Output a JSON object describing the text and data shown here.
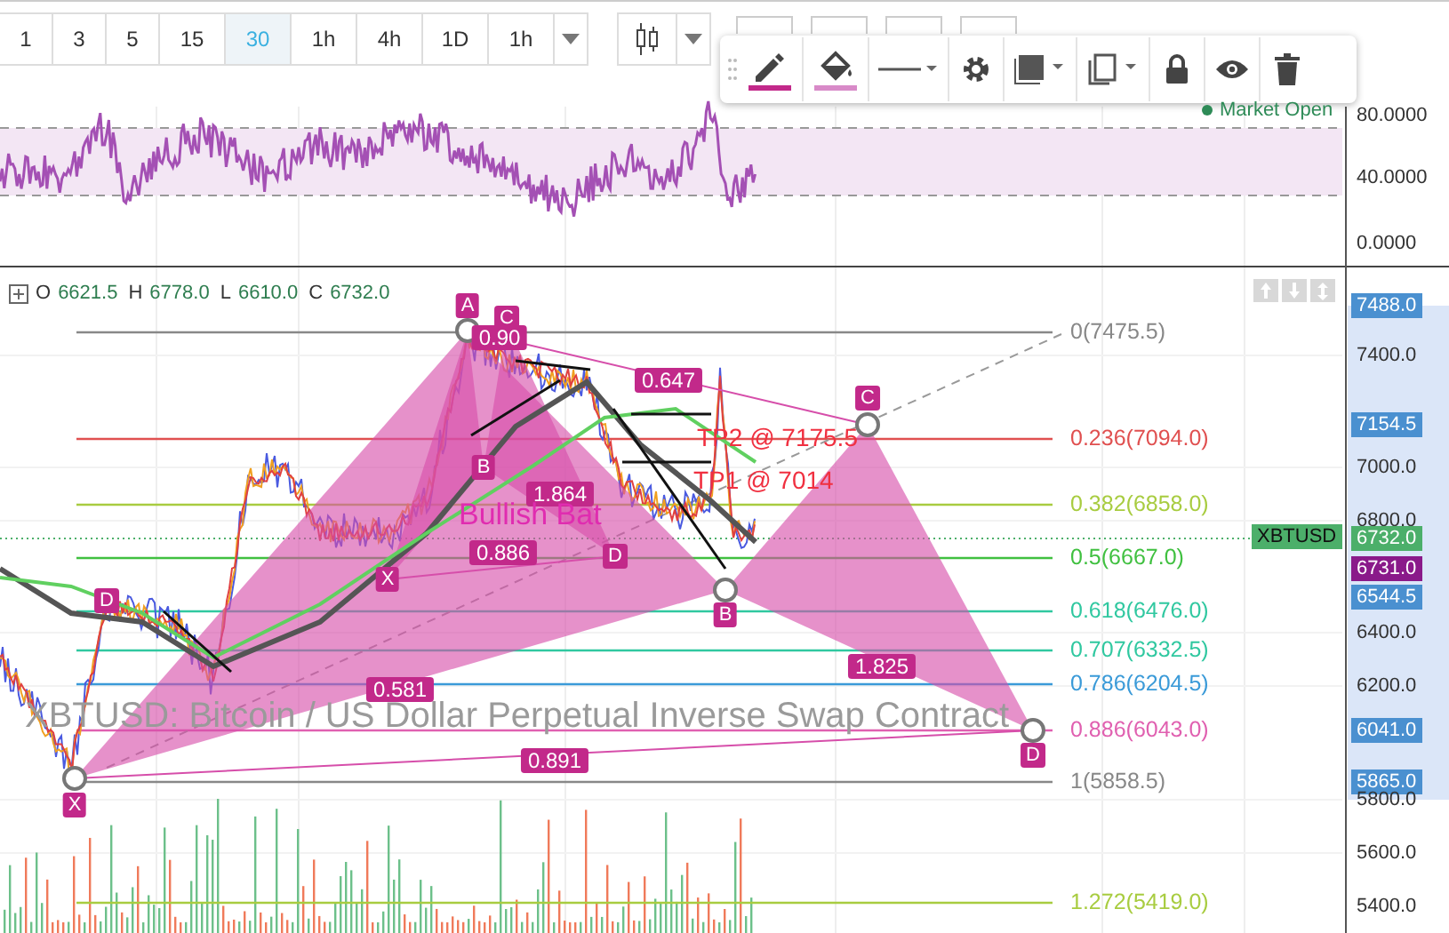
{
  "toolbar": {
    "intervals": [
      {
        "label": "1",
        "selected": false
      },
      {
        "label": "3",
        "selected": false
      },
      {
        "label": "5",
        "selected": false
      },
      {
        "label": "15",
        "selected": false
      },
      {
        "label": "30",
        "selected": true
      },
      {
        "label": "1h",
        "selected": false
      },
      {
        "label": "4h",
        "selected": false
      },
      {
        "label": "1D",
        "selected": false
      },
      {
        "label": "1h",
        "selected": false
      }
    ]
  },
  "rsi_pane": {
    "status": "Market Open",
    "axis_labels": [
      "80.0000",
      "40.0000",
      "0.0000"
    ]
  },
  "price_pane": {
    "ohlc": [
      {
        "key": "O",
        "value": "6621.5"
      },
      {
        "key": "H",
        "value": "6778.0"
      },
      {
        "key": "L",
        "value": "6610.0"
      },
      {
        "key": "C",
        "value": "6732.0"
      }
    ],
    "watermark": {
      "description": "XBTUSD: Bitcoin / US Dollar Perpetual Inverse Swap Contract"
    },
    "symbol_tag": "XBTUSD",
    "axis_labels": [
      {
        "text": "7488.0",
        "kind": "badge",
        "color": "#4a90d0"
      },
      {
        "text": "7400.0",
        "kind": "tick"
      },
      {
        "text": "7154.5",
        "kind": "badge",
        "color": "#4a90d0"
      },
      {
        "text": "7000.0",
        "kind": "tick"
      },
      {
        "text": "6800.0",
        "kind": "tick"
      },
      {
        "text": "6732.0",
        "kind": "badge",
        "color": "#4caf6a"
      },
      {
        "text": "6731.0",
        "kind": "badge",
        "color": "#8a1a8a"
      },
      {
        "text": "6544.5",
        "kind": "badge",
        "color": "#4a90d0"
      },
      {
        "text": "6400.0",
        "kind": "tick"
      },
      {
        "text": "6200.0",
        "kind": "tick"
      },
      {
        "text": "6041.0",
        "kind": "badge",
        "color": "#4a90d0"
      },
      {
        "text": "5865.0",
        "kind": "badge",
        "color": "#4a90d0"
      },
      {
        "text": "5800.0",
        "kind": "tick"
      },
      {
        "text": "5600.0",
        "kind": "tick"
      },
      {
        "text": "5400.0",
        "kind": "tick"
      }
    ],
    "fib_levels": [
      {
        "label": "0(7475.5)",
        "color": "#888888"
      },
      {
        "label": "0.236(7094.0)",
        "color": "#e05050"
      },
      {
        "label": "0.382(6858.0)",
        "color": "#a8cc40"
      },
      {
        "label": "0.5(6667.0)",
        "color": "#40c040"
      },
      {
        "label": "0.618(6476.0)",
        "color": "#30c8a0"
      },
      {
        "label": "0.707(6332.5)",
        "color": "#30c8a0"
      },
      {
        "label": "0.786(6204.5)",
        "color": "#3a9ad8"
      },
      {
        "label": "0.886(6043.0)",
        "color": "#e060b0"
      },
      {
        "label": "1(5858.5)",
        "color": "#888888"
      },
      {
        "label": "1.272(5419.0)",
        "color": "#a8cc40"
      }
    ],
    "pattern": {
      "title": "Bullish Bat",
      "points": [
        "X",
        "A",
        "B",
        "C",
        "D"
      ],
      "inner_points": [
        "C",
        "B",
        "X",
        "D"
      ],
      "ratios": [
        "0.581",
        "0.647",
        "1.825",
        "0.891",
        "0.90",
        "1.864",
        "0.886"
      ],
      "left_marks": [
        "D"
      ],
      "targets": [
        "TP2 @ 7175.5",
        "TP1 @ 7014"
      ]
    }
  }
}
